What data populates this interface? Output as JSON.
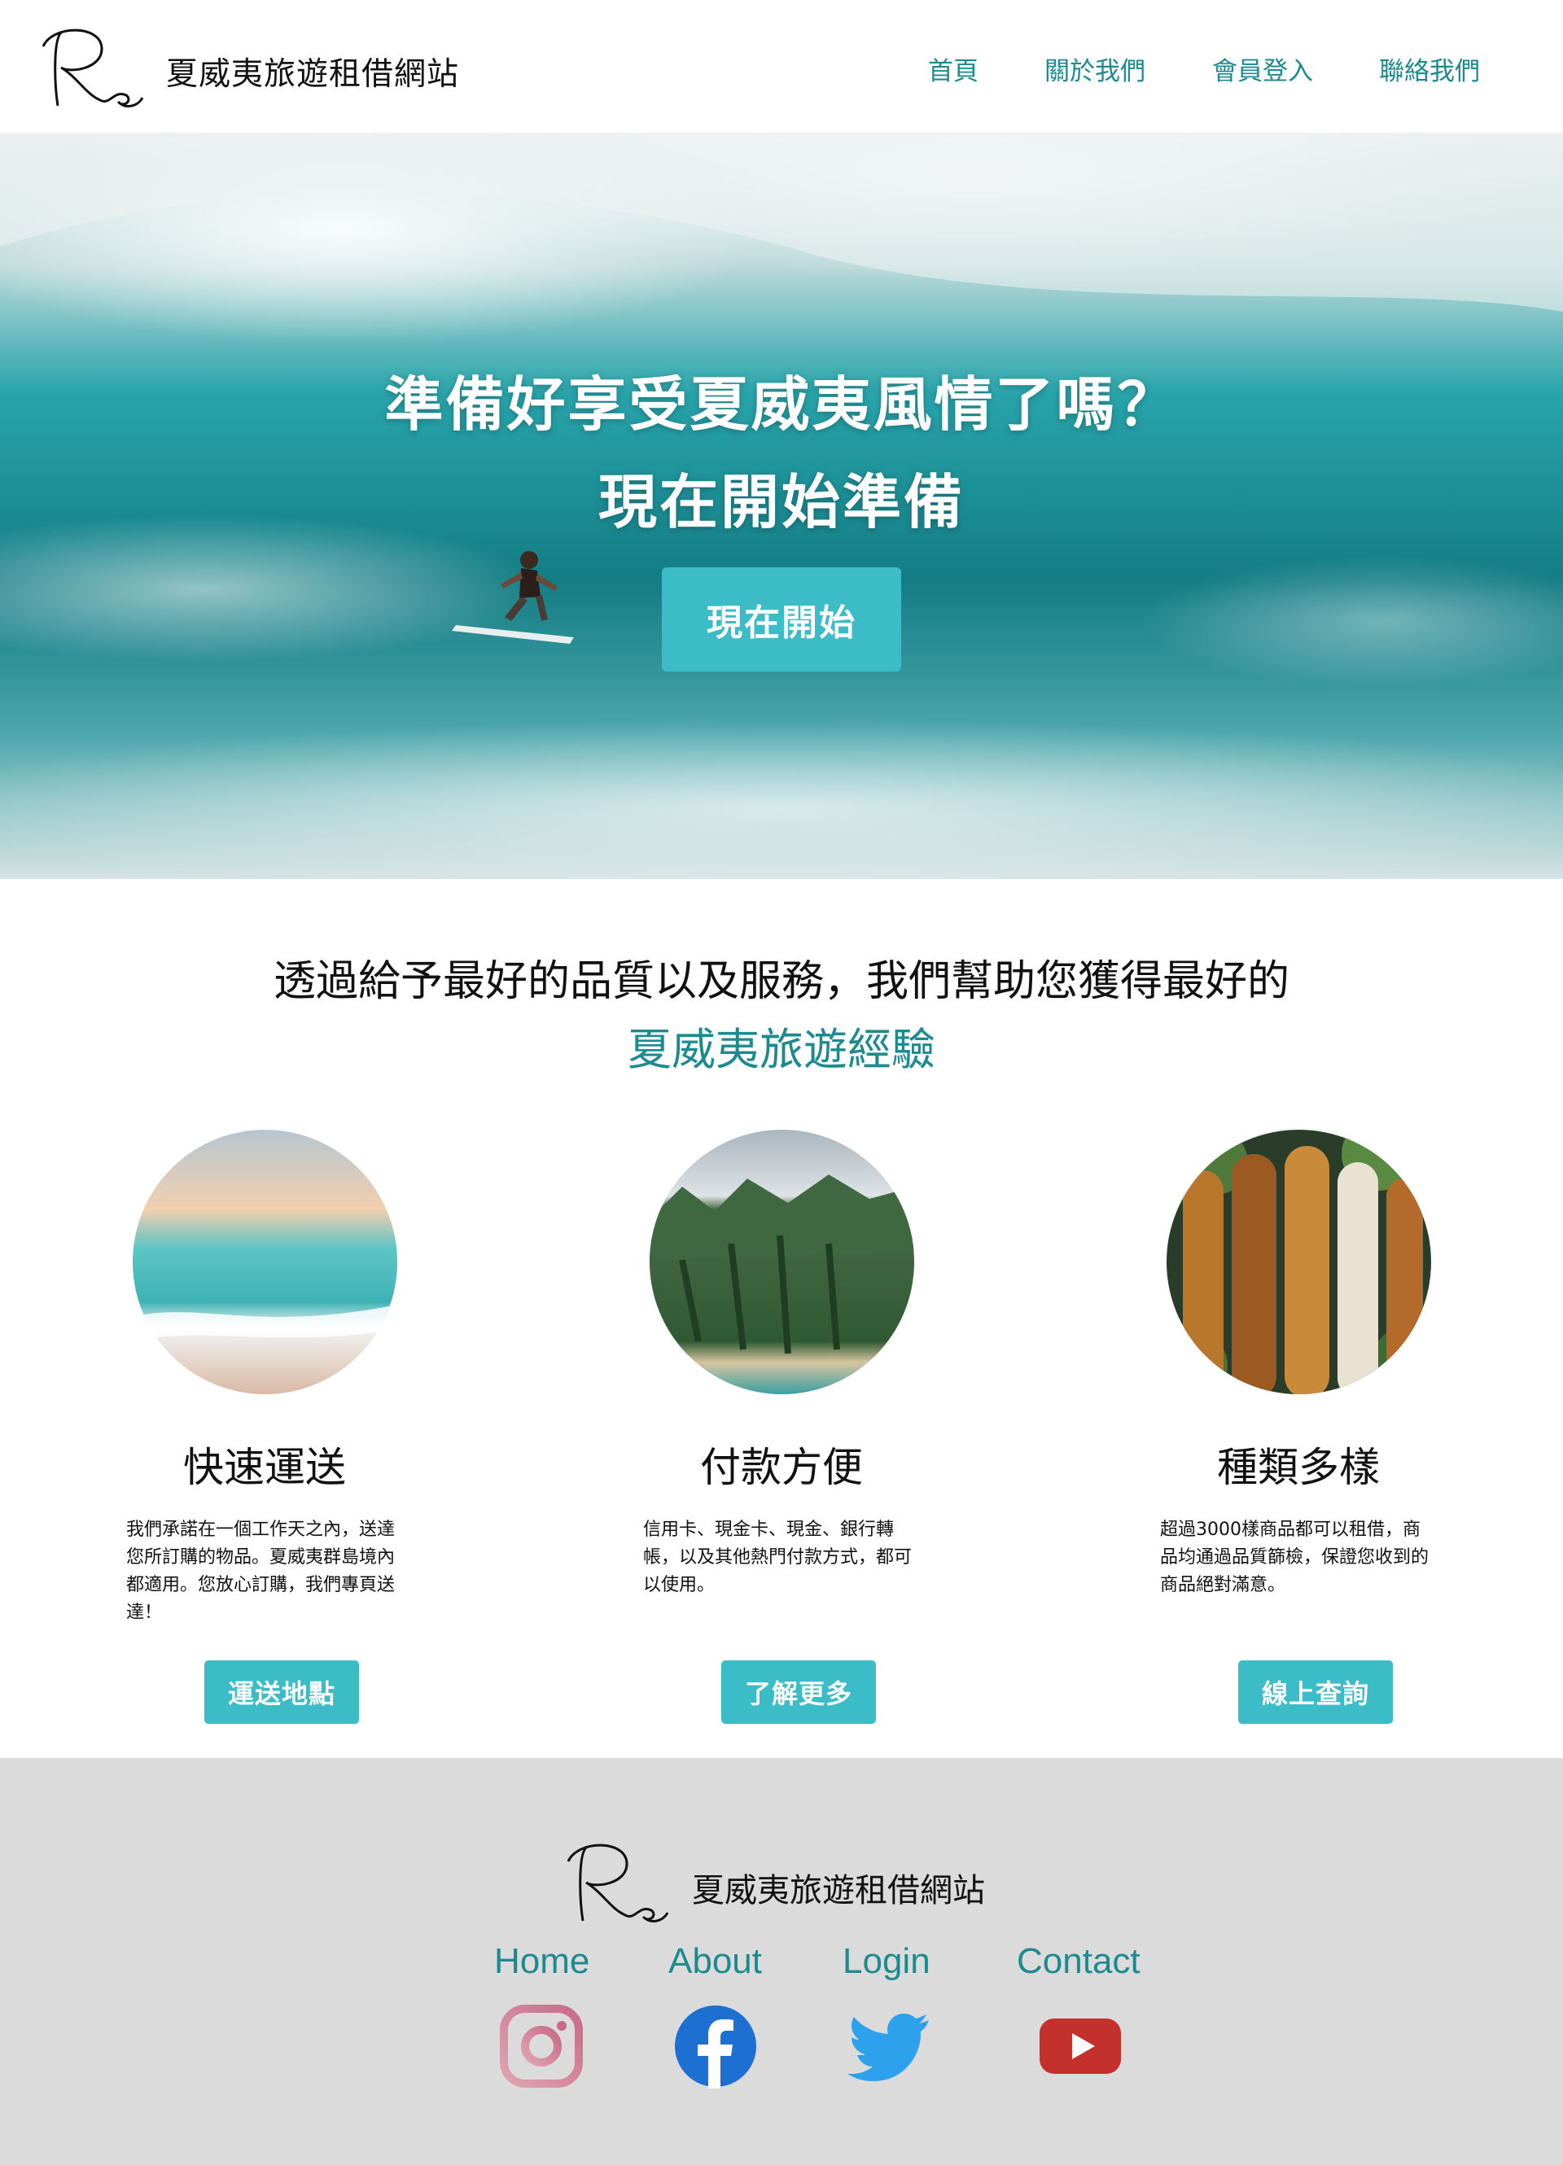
{
  "header": {
    "title": "夏威夷旅遊租借網站",
    "nav": [
      "首頁",
      "關於我們",
      "會員登入",
      "聯絡我們"
    ]
  },
  "hero": {
    "line1": "準備好享受夏威夷風情了嗎？",
    "line2": "現在開始準備",
    "button": "現在開始"
  },
  "intro": {
    "line1": "透過給予最好的品質以及服務，我們幫助您獲得最好的",
    "line2": "夏威夷旅遊經驗"
  },
  "features": [
    {
      "title": "快速運送",
      "text": "我們承諾在一個工作天之內，送達您所訂購的物品。夏威夷群島境內都適用。您放心訂購，我們專頁送達！",
      "button": "運送地點"
    },
    {
      "title": "付款方便",
      "text": "信用卡、現金卡、現金、銀行轉帳，以及其他熱門付款方式，都可以使用。",
      "button": "了解更多"
    },
    {
      "title": "種類多樣",
      "text": "超過3000樣商品都可以租借，商品均通過品質篩檢，保證您收到的商品絕對滿意。",
      "button": "線上查詢"
    }
  ],
  "footer": {
    "title": "夏威夷旅遊租借網站",
    "nav": [
      "Home",
      "About",
      "Login",
      "Contact"
    ],
    "social_icons": [
      "instagram-icon",
      "facebook-icon",
      "twitter-icon",
      "youtube-icon"
    ]
  },
  "colors": {
    "accent": "#3cbcc6",
    "link": "#1c8a8f",
    "footer_bg": "#dcdbdb"
  }
}
